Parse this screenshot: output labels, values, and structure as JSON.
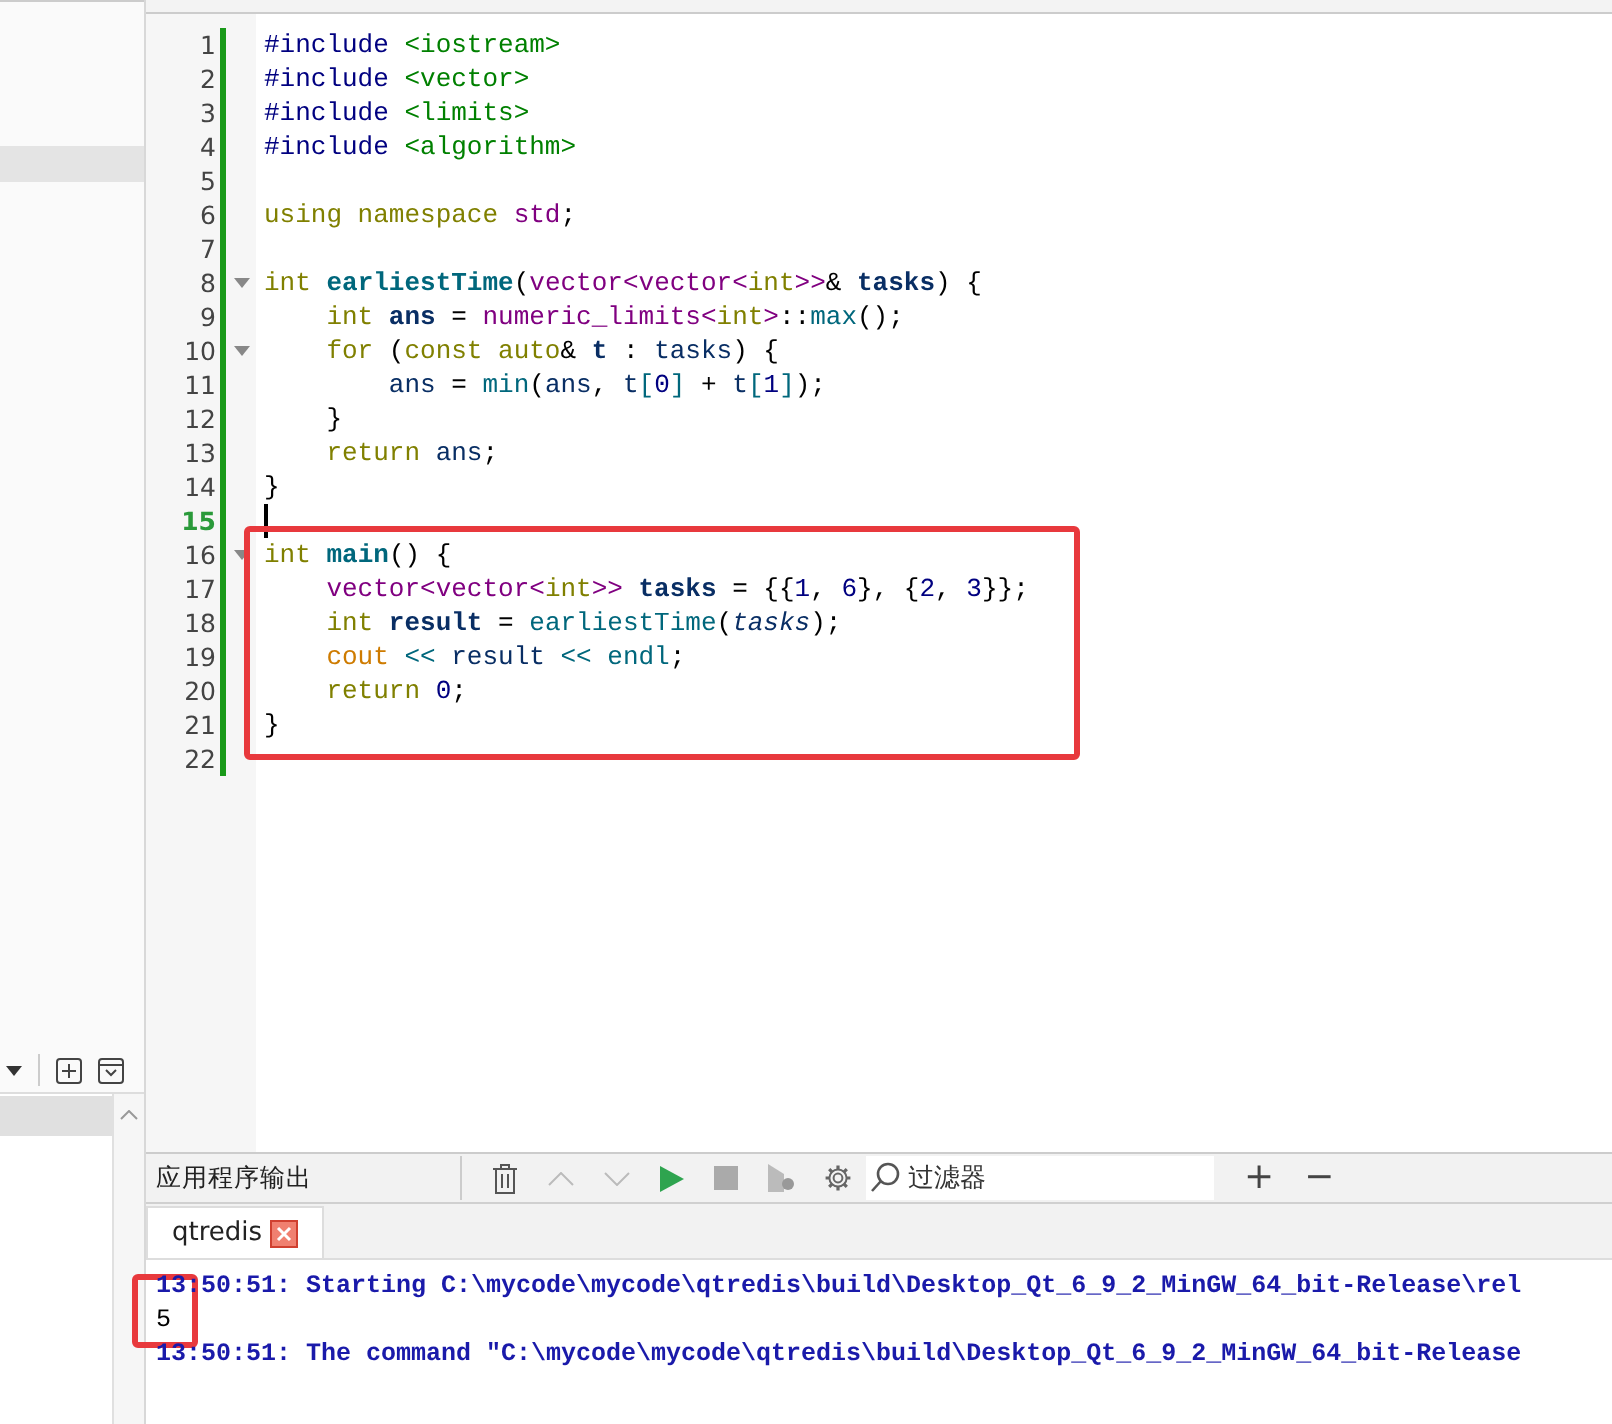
{
  "editor": {
    "lines": [
      {
        "number": "1",
        "fold": false,
        "current": false,
        "tokens": [
          {
            "kind": "pre",
            "text": "#include "
          },
          {
            "kind": "str",
            "text": "<iostream>"
          }
        ]
      },
      {
        "number": "2",
        "fold": false,
        "current": false,
        "tokens": [
          {
            "kind": "pre",
            "text": "#include "
          },
          {
            "kind": "str",
            "text": "<vector>"
          }
        ]
      },
      {
        "number": "3",
        "fold": false,
        "current": false,
        "tokens": [
          {
            "kind": "pre",
            "text": "#include "
          },
          {
            "kind": "str",
            "text": "<limits>"
          }
        ]
      },
      {
        "number": "4",
        "fold": false,
        "current": false,
        "tokens": [
          {
            "kind": "pre",
            "text": "#include "
          },
          {
            "kind": "str",
            "text": "<algorithm>"
          }
        ]
      },
      {
        "number": "5",
        "fold": false,
        "current": false
      },
      {
        "number": "6",
        "fold": false,
        "current": false,
        "tokens": [
          {
            "kind": "kw",
            "text": "using namespace "
          },
          {
            "kind": "cls",
            "text": "std"
          },
          {
            "kind": "plain",
            "text": ";"
          }
        ]
      },
      {
        "number": "7",
        "fold": false,
        "current": false
      },
      {
        "number": "8",
        "fold": true,
        "current": false,
        "tokens": [
          {
            "kind": "kw",
            "text": "int "
          },
          {
            "kind": "fn",
            "text": "earliestTime"
          },
          {
            "kind": "plain",
            "text": "("
          },
          {
            "kind": "cls",
            "text": "vector<vector<"
          },
          {
            "kind": "kw",
            "text": "int"
          },
          {
            "kind": "cls",
            "text": ">>"
          },
          {
            "kind": "plain",
            "text": "& "
          },
          {
            "kind": "decl",
            "text": "tasks"
          },
          {
            "kind": "plain",
            "text": ") {"
          }
        ]
      },
      {
        "number": "9",
        "fold": false,
        "current": false,
        "tokens": [
          {
            "kind": "kw",
            "text": "    int "
          },
          {
            "kind": "decl",
            "text": "ans"
          },
          {
            "kind": "plain",
            "text": " = "
          },
          {
            "kind": "cls",
            "text": "numeric_limits<"
          },
          {
            "kind": "kw",
            "text": "int"
          },
          {
            "kind": "cls",
            "text": ">"
          },
          {
            "kind": "plain",
            "text": "::"
          },
          {
            "kind": "call",
            "text": "max"
          },
          {
            "kind": "plain",
            "text": "();"
          }
        ]
      },
      {
        "number": "10",
        "fold": true,
        "current": false,
        "tokens": [
          {
            "kind": "kw",
            "text": "    for"
          },
          {
            "kind": "plain",
            "text": " ("
          },
          {
            "kind": "kw",
            "text": "const auto"
          },
          {
            "kind": "plain",
            "text": "& "
          },
          {
            "kind": "decl",
            "text": "t"
          },
          {
            "kind": "plain",
            "text": " : "
          },
          {
            "kind": "var",
            "text": "tasks"
          },
          {
            "kind": "plain",
            "text": ") {"
          }
        ]
      },
      {
        "number": "11",
        "fold": false,
        "current": false,
        "tokens": [
          {
            "kind": "var",
            "text": "        ans"
          },
          {
            "kind": "plain",
            "text": " = "
          },
          {
            "kind": "call",
            "text": "min"
          },
          {
            "kind": "plain",
            "text": "("
          },
          {
            "kind": "var",
            "text": "ans"
          },
          {
            "kind": "plain",
            "text": ", "
          },
          {
            "kind": "var",
            "text": "t"
          },
          {
            "kind": "op",
            "text": "["
          },
          {
            "kind": "num",
            "text": "0"
          },
          {
            "kind": "op",
            "text": "]"
          },
          {
            "kind": "plain",
            "text": " + "
          },
          {
            "kind": "var",
            "text": "t"
          },
          {
            "kind": "op",
            "text": "["
          },
          {
            "kind": "num",
            "text": "1"
          },
          {
            "kind": "op",
            "text": "]"
          },
          {
            "kind": "plain",
            "text": ");"
          }
        ]
      },
      {
        "number": "12",
        "fold": false,
        "current": false,
        "tokens": [
          {
            "kind": "plain",
            "text": "    }"
          }
        ]
      },
      {
        "number": "13",
        "fold": false,
        "current": false,
        "tokens": [
          {
            "kind": "kw",
            "text": "    return "
          },
          {
            "kind": "var",
            "text": "ans"
          },
          {
            "kind": "plain",
            "text": ";"
          }
        ]
      },
      {
        "number": "14",
        "fold": false,
        "current": false,
        "tokens": [
          {
            "kind": "plain",
            "text": "}"
          }
        ]
      },
      {
        "number": "15",
        "fold": false,
        "current": true
      },
      {
        "number": "16",
        "fold": true,
        "current": false,
        "tokens": [
          {
            "kind": "kw",
            "text": "int "
          },
          {
            "kind": "fn",
            "text": "main"
          },
          {
            "kind": "plain",
            "text": "() {"
          }
        ]
      },
      {
        "number": "17",
        "fold": false,
        "current": false,
        "tokens": [
          {
            "kind": "cls",
            "text": "    vector<vector<"
          },
          {
            "kind": "kw",
            "text": "int"
          },
          {
            "kind": "cls",
            "text": ">> "
          },
          {
            "kind": "decl",
            "text": "tasks"
          },
          {
            "kind": "plain",
            "text": " = {{"
          },
          {
            "kind": "num",
            "text": "1"
          },
          {
            "kind": "plain",
            "text": ", "
          },
          {
            "kind": "num",
            "text": "6"
          },
          {
            "kind": "plain",
            "text": "}, {"
          },
          {
            "kind": "num",
            "text": "2"
          },
          {
            "kind": "plain",
            "text": ", "
          },
          {
            "kind": "num",
            "text": "3"
          },
          {
            "kind": "plain",
            "text": "}};"
          }
        ]
      },
      {
        "number": "18",
        "fold": false,
        "current": false,
        "tokens": [
          {
            "kind": "kw",
            "text": "    int "
          },
          {
            "kind": "decl",
            "text": "result"
          },
          {
            "kind": "plain",
            "text": " = "
          },
          {
            "kind": "call",
            "text": "earliestTime"
          },
          {
            "kind": "plain",
            "text": "("
          },
          {
            "kind": "arg",
            "text": "tasks"
          },
          {
            "kind": "plain",
            "text": ");"
          }
        ]
      },
      {
        "number": "19",
        "fold": false,
        "current": false,
        "tokens": [
          {
            "kind": "stream",
            "text": "    cout "
          },
          {
            "kind": "call",
            "text": "<< "
          },
          {
            "kind": "var",
            "text": "result "
          },
          {
            "kind": "call",
            "text": "<< endl"
          },
          {
            "kind": "plain",
            "text": ";"
          }
        ]
      },
      {
        "number": "20",
        "fold": false,
        "current": false,
        "tokens": [
          {
            "kind": "kw",
            "text": "    return "
          },
          {
            "kind": "num",
            "text": "0"
          },
          {
            "kind": "plain",
            "text": ";"
          }
        ]
      },
      {
        "number": "21",
        "fold": false,
        "current": false,
        "tokens": [
          {
            "kind": "plain",
            "text": "}"
          }
        ]
      },
      {
        "number": "22",
        "fold": false,
        "current": false
      }
    ]
  },
  "output_panel": {
    "title": "应用程序输出",
    "filter": {
      "placeholder": "过滤器"
    },
    "actions": [
      "+",
      "−"
    ],
    "tabs": [
      {
        "label": "qtredis",
        "selected": true
      }
    ],
    "lines": [
      {
        "kind": "info",
        "text": "13:50:51: Starting C:\\mycode\\mycode\\qtredis\\build\\Desktop_Qt_6_9_2_MinGW_64_bit-Release\\rel"
      },
      {
        "kind": "plain",
        "text": "5"
      },
      {
        "kind": "info",
        "text": "13:50:51: The command \"C:\\mycode\\mycode\\qtredis\\build\\Desktop_Qt_6_9_2_MinGW_64_bit-Release"
      }
    ]
  }
}
